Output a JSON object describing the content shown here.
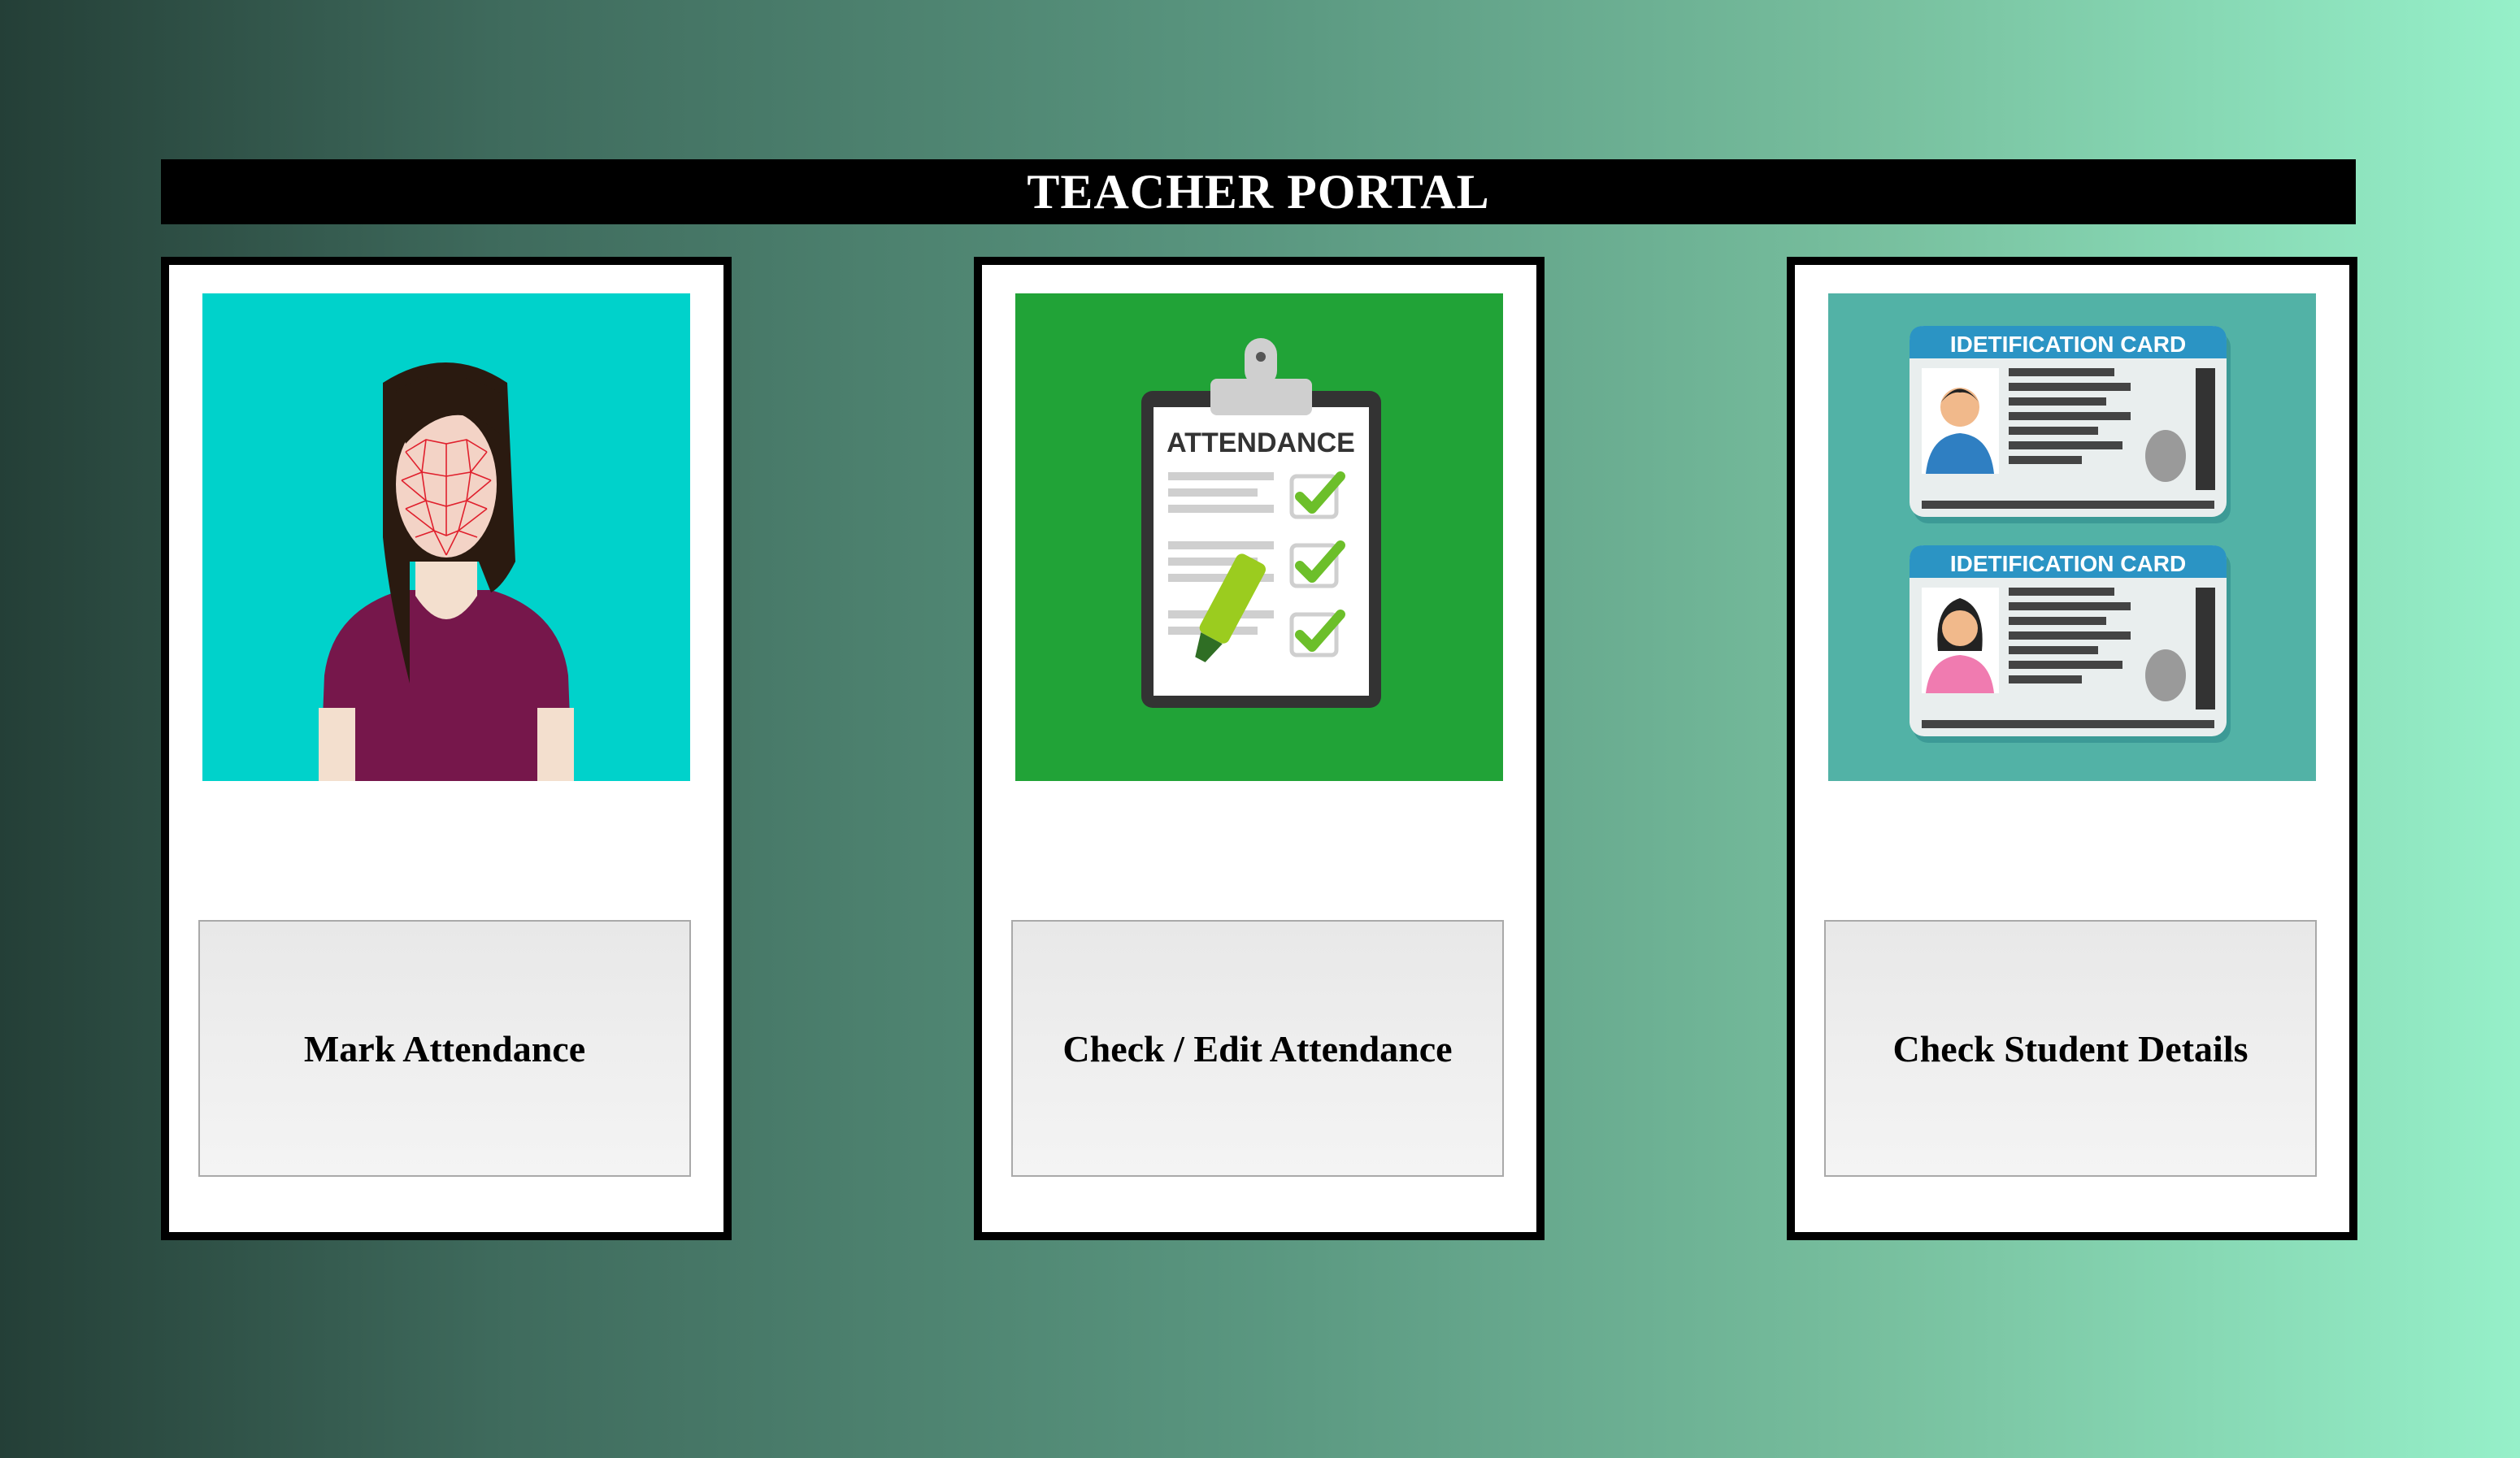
{
  "header": {
    "title": "TEACHER PORTAL"
  },
  "cards": [
    {
      "button_label": "Mark Attendance",
      "image_icon": "face-recognition-icon",
      "image_bg": "#00d2cb"
    },
    {
      "button_label": "Check / Edit Attendance",
      "image_icon": "attendance-clipboard-icon",
      "image_bg": "#21a337",
      "image_text": "ATTENDANCE"
    },
    {
      "button_label": "Check Student Details",
      "image_icon": "id-card-icon",
      "image_bg": "#52b2a6",
      "image_text": [
        "IDETIFICATION CARD",
        "IDETIFICATION CARD"
      ]
    }
  ],
  "colors": {
    "title_bar": "#000000",
    "title_text": "#ffffff",
    "card_border": "#000000"
  }
}
